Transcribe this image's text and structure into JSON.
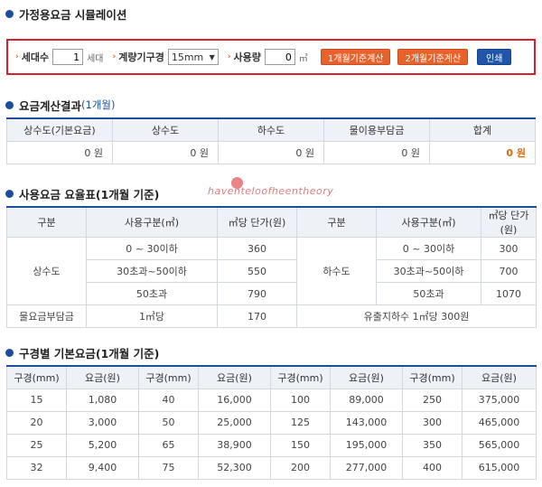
{
  "sim_title": "가정용요금 시뮬레이션",
  "calc": {
    "households_label": "세대수",
    "households_value": "1",
    "households_unit": "세대",
    "meter_label": "계량기구경",
    "meter_value": "15mm",
    "usage_label": "사용량",
    "usage_value": "0",
    "usage_unit": "㎥",
    "btn_calc1": "1개월기준계산",
    "btn_calc2": "2개월기준계산",
    "btn_print": "인쇄"
  },
  "result": {
    "title": "요금계산결과",
    "subtitle": "(1개월)",
    "headers": [
      "상수도(기본요금)",
      "상수도",
      "하수도",
      "물이용부담금",
      "합계"
    ],
    "values": [
      "0 원",
      "0 원",
      "0 원",
      "0 원",
      "0 원"
    ]
  },
  "rate": {
    "title": "사용요금 요율표(1개월 기준)",
    "headers": [
      "구분",
      "사용구분(㎥)",
      "㎥당 단가(원)",
      "구분",
      "사용구분(㎥)",
      "㎥당 단가(원)"
    ],
    "water_label": "상수도",
    "sewer_label": "하수도",
    "water_rows": [
      [
        "0 ~ 30이하",
        "360"
      ],
      [
        "30초과~50이하",
        "550"
      ],
      [
        "50초과",
        "790"
      ]
    ],
    "sewer_rows": [
      [
        "0 ~ 30이하",
        "300"
      ],
      [
        "30초과~50이하",
        "700"
      ],
      [
        "50초과",
        "1070"
      ]
    ],
    "charge_label": "물요금부담금",
    "charge_unit": "1㎥당",
    "charge_price": "170",
    "note": "유출지하수 1㎥당 300원"
  },
  "base": {
    "title": "구경별 기본요금(1개월 기준)",
    "headers": [
      "구경(mm)",
      "요금(원)",
      "구경(mm)",
      "요금(원)",
      "구경(mm)",
      "요금(원)",
      "구경(mm)",
      "요금(원)"
    ],
    "rows": [
      [
        "15",
        "1,080",
        "40",
        "16,000",
        "100",
        "89,000",
        "250",
        "375,000"
      ],
      [
        "20",
        "3,000",
        "50",
        "25,000",
        "125",
        "143,000",
        "300",
        "465,000"
      ],
      [
        "25",
        "5,200",
        "65",
        "38,900",
        "150",
        "195,000",
        "350",
        "565,000"
      ],
      [
        "32",
        "9,400",
        "75",
        "52,300",
        "200",
        "277,000",
        "400",
        "615,000"
      ]
    ]
  },
  "watermark": "haventeloofheentheory"
}
